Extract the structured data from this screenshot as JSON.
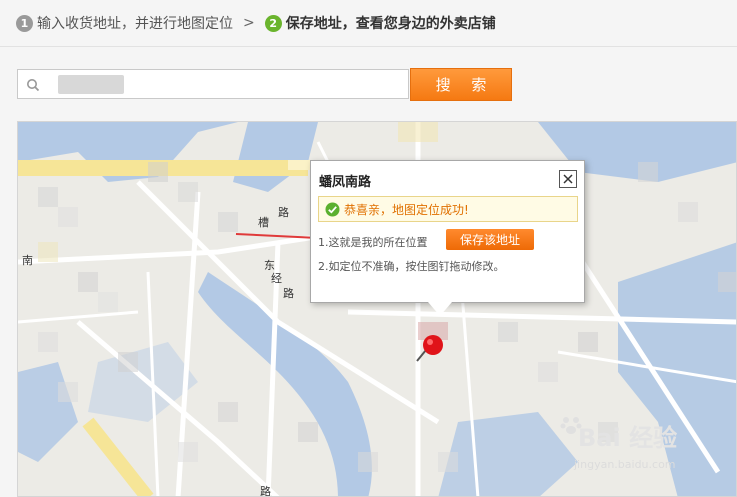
{
  "steps": [
    {
      "num": "1",
      "label": "输入收货地址，并进行地图定位"
    },
    {
      "num": "2",
      "label": "保存地址，查看您身边的外卖店铺"
    }
  ],
  "step_separator": ">",
  "search": {
    "placeholder": "",
    "button_label": "搜 索"
  },
  "map": {
    "road_labels": [
      "槽",
      "路",
      "东",
      "经",
      "路",
      "南",
      "路"
    ],
    "popup": {
      "title": "蟠凤南路",
      "success_message": "恭喜亲，地图定位成功!",
      "tip1": "1.这就是我的所在位置",
      "tip2": "2.如定位不准确，按住图钉拖动修改。",
      "save_button_label": "保存该地址"
    }
  },
  "watermark": {
    "brand_a": "Bai",
    "brand_b": "经验",
    "url": "jingyan.baidu.com"
  },
  "colors": {
    "accent": "#f57912",
    "success": "#6ab42d",
    "water": "#a9c3e4"
  }
}
